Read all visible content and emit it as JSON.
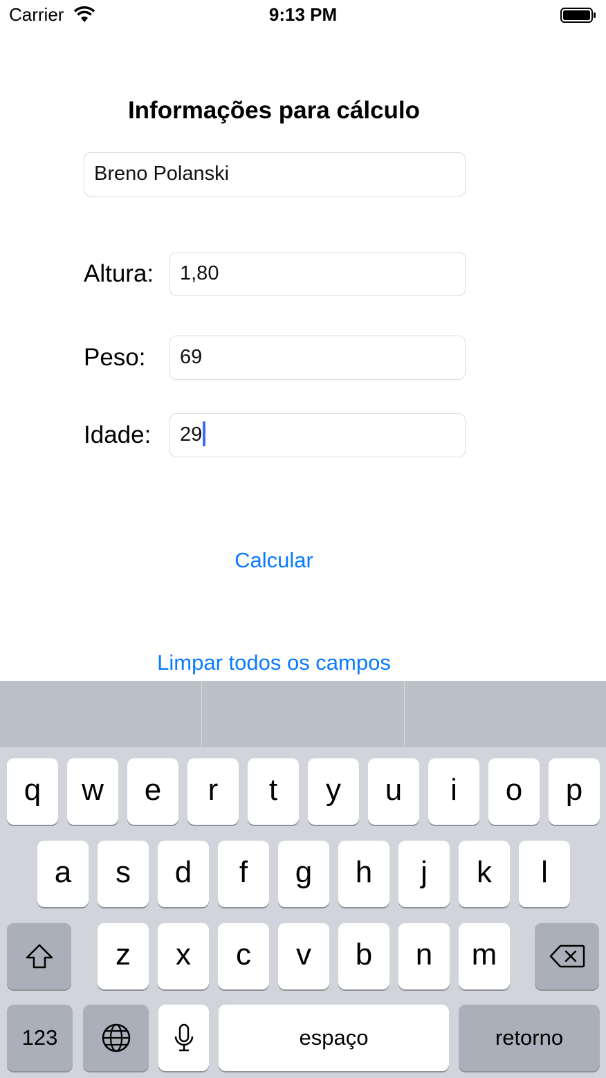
{
  "status_bar": {
    "carrier": "Carrier",
    "time": "9:13 PM"
  },
  "form": {
    "title": "Informações para cálculo",
    "name_value": "Breno Polanski",
    "altura_label": "Altura:",
    "altura_value": "1,80",
    "peso_label": "Peso:",
    "peso_value": "69",
    "idade_label": "Idade:",
    "idade_value": "29",
    "calcular_label": "Calcular",
    "limpar_label": "Limpar todos os campos"
  },
  "keyboard": {
    "row1": [
      "q",
      "w",
      "e",
      "r",
      "t",
      "y",
      "u",
      "i",
      "o",
      "p"
    ],
    "row2": [
      "a",
      "s",
      "d",
      "f",
      "g",
      "h",
      "j",
      "k",
      "l"
    ],
    "row3": [
      "z",
      "x",
      "c",
      "v",
      "b",
      "n",
      "m"
    ],
    "numbers_label": "123",
    "space_label": "espaço",
    "return_label": "retorno"
  },
  "colors": {
    "accent": "#0a7aff",
    "caret": "#3a6cf0",
    "keyboard_bg": "#d1d4da",
    "key_dark": "#abafb9"
  }
}
